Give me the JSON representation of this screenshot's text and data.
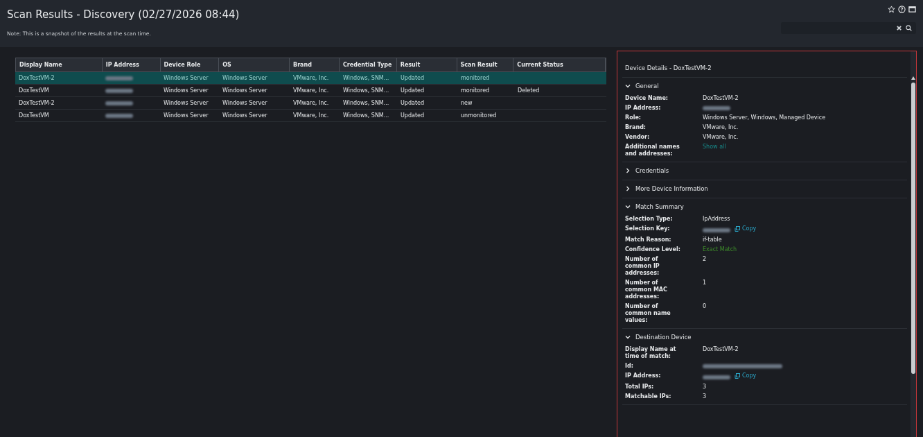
{
  "header": {
    "title": "Scan Results - Discovery (02/27/2026 08:44)",
    "note": "Note: This is a snapshot of the results at the scan time."
  },
  "table": {
    "columns": [
      "Display Name",
      "IP Address",
      "Device Role",
      "OS",
      "Brand",
      "Credential Type",
      "Result",
      "Scan Result",
      "Current Status"
    ],
    "rows": [
      {
        "selected": true,
        "cells": [
          {
            "kind": "text",
            "text": "DoxTestVM-2"
          },
          {
            "kind": "redacted"
          },
          {
            "kind": "text",
            "text": "Windows Server"
          },
          {
            "kind": "text",
            "text": "Windows Server"
          },
          {
            "kind": "text",
            "text": "VMware, Inc."
          },
          {
            "kind": "text",
            "text": "Windows, SNM..."
          },
          {
            "kind": "text",
            "text": "Updated"
          },
          {
            "kind": "text",
            "text": "monitored"
          },
          {
            "kind": "empty"
          }
        ]
      },
      {
        "selected": false,
        "cells": [
          {
            "kind": "text",
            "text": "DoxTestVM"
          },
          {
            "kind": "redacted"
          },
          {
            "kind": "text",
            "text": "Windows Server"
          },
          {
            "kind": "text",
            "text": "Windows Server"
          },
          {
            "kind": "text",
            "text": "VMware, Inc."
          },
          {
            "kind": "text",
            "text": "Windows, SNM..."
          },
          {
            "kind": "text",
            "text": "Updated"
          },
          {
            "kind": "text",
            "text": "monitored"
          },
          {
            "kind": "text",
            "text": "Deleted"
          }
        ]
      },
      {
        "selected": false,
        "cells": [
          {
            "kind": "text",
            "text": "DoxTestVM-2"
          },
          {
            "kind": "redacted"
          },
          {
            "kind": "text",
            "text": "Windows Server"
          },
          {
            "kind": "text",
            "text": "Windows Server"
          },
          {
            "kind": "text",
            "text": "VMware, Inc."
          },
          {
            "kind": "text",
            "text": "Windows, SNM..."
          },
          {
            "kind": "text",
            "text": "Updated"
          },
          {
            "kind": "text",
            "text": "new"
          },
          {
            "kind": "empty"
          }
        ]
      },
      {
        "selected": false,
        "cells": [
          {
            "kind": "text",
            "text": "DoxTestVM"
          },
          {
            "kind": "redacted"
          },
          {
            "kind": "text",
            "text": "Windows Server"
          },
          {
            "kind": "text",
            "text": "Windows Server"
          },
          {
            "kind": "text",
            "text": "VMware, Inc."
          },
          {
            "kind": "text",
            "text": "Windows, SNM..."
          },
          {
            "kind": "text",
            "text": "Updated"
          },
          {
            "kind": "text",
            "text": "unmonitored"
          },
          {
            "kind": "empty"
          }
        ]
      }
    ]
  },
  "details": {
    "title": "Device Details - DoxTestVM-2",
    "sections": [
      {
        "title": "General",
        "expanded": true,
        "rows": [
          {
            "label": "Device Name:",
            "kind": "text",
            "value": "DoxTestVM-2"
          },
          {
            "label": "IP Address:",
            "kind": "redacted"
          },
          {
            "label": "Role:",
            "kind": "text",
            "value": "Windows Server, Windows, Managed Device"
          },
          {
            "label": "Brand:",
            "kind": "text",
            "value": "VMware, Inc."
          },
          {
            "label": "Vendor:",
            "kind": "text",
            "value": "VMware, Inc."
          },
          {
            "label": "Additional names and addresses:",
            "kind": "link",
            "value": "Show all"
          }
        ]
      },
      {
        "title": "Credentials",
        "expanded": false
      },
      {
        "title": "More Device Information",
        "expanded": false
      },
      {
        "title": "Match Summary",
        "expanded": true,
        "rows": [
          {
            "label": "Selection Type:",
            "kind": "text",
            "value": "IpAddress"
          },
          {
            "label": "Selection Key:",
            "kind": "redacted_copy",
            "value": "Copy"
          },
          {
            "label": "Match Reason:",
            "kind": "text",
            "value": "if-table"
          },
          {
            "label": "Confidence Level:",
            "kind": "success",
            "value": "Exact Match"
          },
          {
            "label": "Number of common IP addresses:",
            "kind": "text",
            "value": "2"
          },
          {
            "label": "Number of common MAC addresses:",
            "kind": "text",
            "value": "1"
          },
          {
            "label": "Number of common name values:",
            "kind": "text",
            "value": "0"
          }
        ]
      },
      {
        "title": "Destination Device",
        "expanded": true,
        "rows": [
          {
            "label": "Display Name at time of match:",
            "kind": "text",
            "value": "DoxTestVM-2"
          },
          {
            "label": "Id:",
            "kind": "redacted_long"
          },
          {
            "label": "IP Address:",
            "kind": "redacted_copy",
            "value": "Copy"
          },
          {
            "label": "Total IPs:",
            "kind": "text",
            "value": "3"
          },
          {
            "label": "Matchable IPs:",
            "kind": "text",
            "value": "3"
          }
        ]
      }
    ]
  }
}
